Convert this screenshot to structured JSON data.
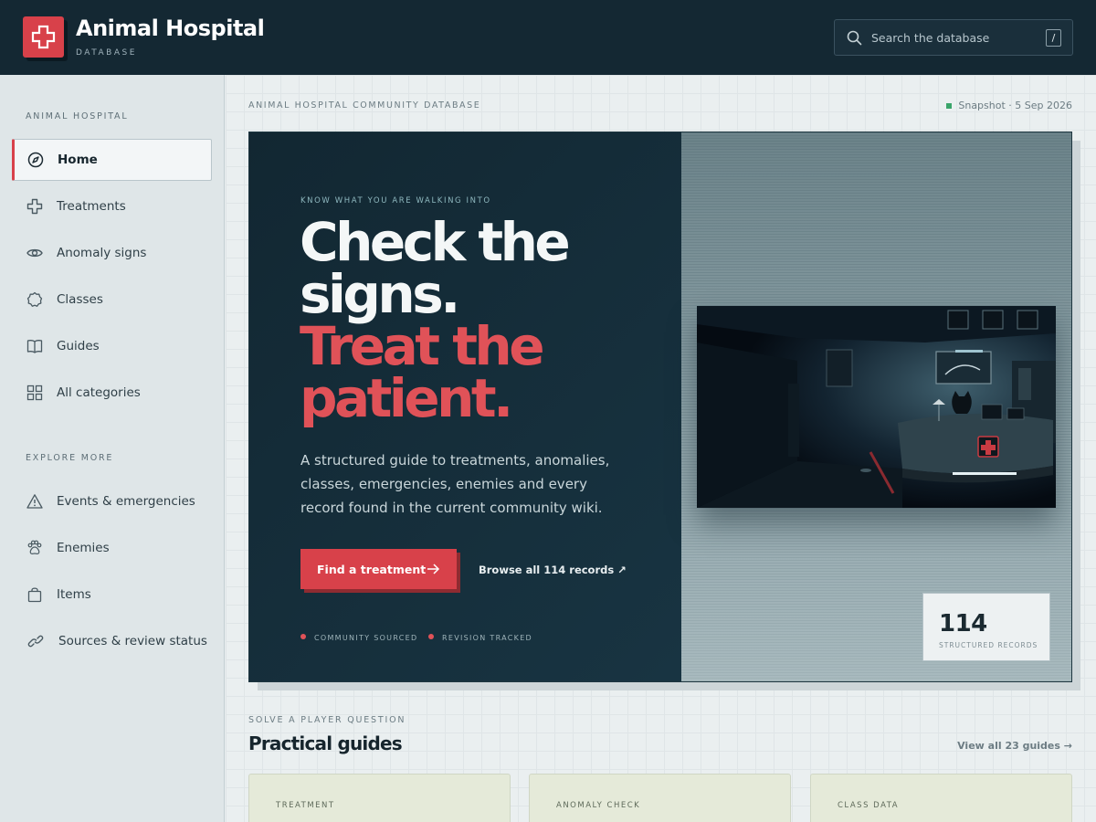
{
  "header": {
    "brand_title": "Animal Hospital",
    "brand_subtitle": "DATABASE",
    "search_placeholder": "Search the database",
    "search_shortcut": "/"
  },
  "sidebar": {
    "section1_title": "ANIMAL HOSPITAL",
    "section2_title": "EXPLORE MORE",
    "items": [
      {
        "label": "Home",
        "icon": "compass-icon",
        "active": true
      },
      {
        "label": "Treatments",
        "icon": "cross-icon"
      },
      {
        "label": "Anomaly signs",
        "icon": "eye-icon"
      },
      {
        "label": "Classes",
        "icon": "badge-icon"
      },
      {
        "label": "Guides",
        "icon": "book-icon"
      },
      {
        "label": "All categories",
        "icon": "grid-icon"
      },
      {
        "label": "Events & emergencies",
        "icon": "warning-icon"
      },
      {
        "label": "Enemies",
        "icon": "paw-icon"
      },
      {
        "label": "Items",
        "icon": "bag-icon"
      },
      {
        "label": "Sources & review status",
        "icon": "link-icon"
      }
    ]
  },
  "main": {
    "kicker": "ANIMAL HOSPITAL COMMUNITY DATABASE",
    "snapshot": "Snapshot · 5 Sep 2026",
    "hero": {
      "eyebrow": "KNOW WHAT YOU ARE WALKING INTO",
      "headline_line1": "Check the",
      "headline_line2": "signs.",
      "headline_line3": "Treat the",
      "headline_line4": "patient.",
      "lede": "A structured guide to treatments, anomalies, classes, emergencies, enemies and every record found in the current community wiki.",
      "cta_label": "Find a treatment",
      "browse_label": "Browse all 114 records ↗",
      "tag1": "COMMUNITY SOURCED",
      "tag2": "REVISION TRACKED",
      "stat_value": "114",
      "stat_label": "STRUCTURED RECORDS"
    },
    "guides": {
      "kicker": "SOLVE A PLAYER QUESTION",
      "title": "Practical guides",
      "view_all": "View all 23 guides →",
      "cards": [
        "TREATMENT",
        "ANOMALY CHECK",
        "CLASS DATA"
      ]
    }
  },
  "colors": {
    "accent": "#d8414a",
    "header_bg": "#142833",
    "hero_bg": "#142b37"
  }
}
